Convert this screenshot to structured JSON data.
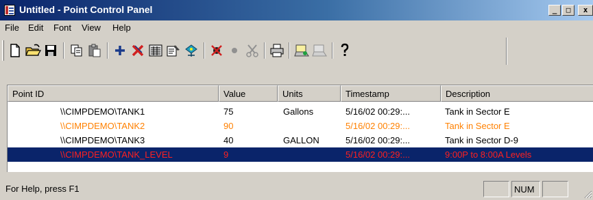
{
  "window": {
    "title": "Untitled - Point Control Panel",
    "caption_buttons": [
      "_",
      "□",
      "x"
    ]
  },
  "menu": [
    "File",
    "Edit",
    "Font",
    "View",
    "Help"
  ],
  "toolbar_icons": [
    "new-file-icon",
    "open-folder-icon",
    "save-icon",
    "copy-icon",
    "paste-icon",
    "add-point-icon",
    "delete-point-icon",
    "point-list-icon",
    "properties-icon",
    "refresh-icon",
    "disable-alarm-icon",
    "status-dot-icon",
    "cut-icon",
    "print-icon",
    "connect-icon",
    "disconnect-icon",
    "help-icon"
  ],
  "list": {
    "columns": [
      "Point ID",
      "Value",
      "Units",
      "Timestamp",
      "Description"
    ],
    "rows": [
      {
        "point_id": "\\\\CIMPDEMO\\TANK1",
        "value": "75",
        "units": "Gallons",
        "timestamp": "5/16/02 00:29:...",
        "description": "Tank in Sector E",
        "color": "#000000"
      },
      {
        "point_id": "\\\\CIMPDEMO\\TANK2",
        "value": "90",
        "units": "",
        "timestamp": "5/16/02 00:29:...",
        "description": "Tank in Sector E",
        "color": "#ff8000"
      },
      {
        "point_id": "\\\\CIMPDEMO\\TANK3",
        "value": "40",
        "units": "GALLON",
        "timestamp": "5/16/02 00:29:...",
        "description": "Tank in Sector D-9",
        "color": "#000000"
      },
      {
        "point_id": "\\\\CIMPDEMO\\TANK_LEVEL",
        "value": "9",
        "units": "",
        "timestamp": "5/16/02 00:29:...",
        "description": "9:00P to 8:00A Levels",
        "color": "#ff2020",
        "selected": true
      }
    ]
  },
  "status": {
    "text": "For Help, press F1",
    "panes": [
      "",
      "NUM",
      ""
    ]
  }
}
